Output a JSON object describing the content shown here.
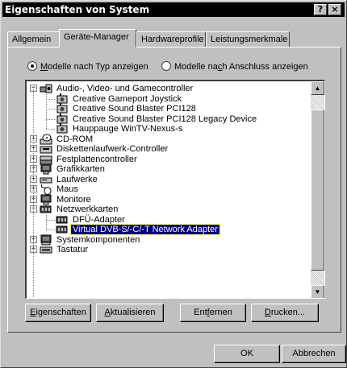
{
  "window": {
    "title": "Eigenschaften von System",
    "help_button": "?",
    "close_button": "×"
  },
  "tabs": [
    {
      "label": "Allgemein",
      "active": false
    },
    {
      "label": "Geräte-Manager",
      "active": true
    },
    {
      "label": "Hardwareprofile",
      "active": false
    },
    {
      "label": "Leistungsmerkmale",
      "active": false
    }
  ],
  "view_options": {
    "by_type": {
      "prefix": "",
      "accel": "M",
      "rest": "odelle nach Typ anzeigen",
      "checked": true
    },
    "by_connection": {
      "prefix": "Modelle na",
      "accel": "c",
      "rest": "h Anschluss anzeigen",
      "checked": false
    }
  },
  "tree": [
    {
      "level": 0,
      "expander": "−",
      "icon": "audio-icon",
      "label": "Audio-, Video- und Gamecontroller"
    },
    {
      "level": 1,
      "expander": "",
      "icon": "audio-device-icon",
      "label": "Creative Gameport Joystick"
    },
    {
      "level": 1,
      "expander": "",
      "icon": "audio-device-icon",
      "label": "Creative Sound Blaster PCI128"
    },
    {
      "level": 1,
      "expander": "",
      "icon": "audio-device-icon",
      "label": "Creative Sound Blaster PCI128 Legacy Device"
    },
    {
      "level": 1,
      "expander": "",
      "icon": "audio-device-icon",
      "label": "Hauppauge WinTV-Nexus-s"
    },
    {
      "level": 0,
      "expander": "+",
      "icon": "cdrom-icon",
      "label": "CD-ROM"
    },
    {
      "level": 0,
      "expander": "+",
      "icon": "floppy-icon",
      "label": "Diskettenlaufwerk-Controller"
    },
    {
      "level": 0,
      "expander": "+",
      "icon": "hdd-controller-icon",
      "label": "Festplattencontroller"
    },
    {
      "level": 0,
      "expander": "+",
      "icon": "graphics-card-icon",
      "label": "Grafikkarten"
    },
    {
      "level": 0,
      "expander": "+",
      "icon": "drive-icon",
      "label": "Laufwerke"
    },
    {
      "level": 0,
      "expander": "+",
      "icon": "mouse-icon",
      "label": "Maus"
    },
    {
      "level": 0,
      "expander": "+",
      "icon": "monitor-icon",
      "label": "Monitore"
    },
    {
      "level": 0,
      "expander": "−",
      "icon": "network-card-icon",
      "label": "Netzwerkkarten"
    },
    {
      "level": 1,
      "expander": "",
      "icon": "network-card-icon",
      "label": "DFÜ-Adapter"
    },
    {
      "level": 1,
      "expander": "",
      "icon": "network-card-icon",
      "label": "Virtual DVB-S/-C/-T Network Adapter",
      "selected": true
    },
    {
      "level": 0,
      "expander": "+",
      "icon": "system-component-icon",
      "label": "Systemkomponenten"
    },
    {
      "level": 0,
      "expander": "+",
      "icon": "keyboard-icon",
      "label": "Tastatur"
    }
  ],
  "buttons": {
    "properties": {
      "accel": "E",
      "rest": "igenschaften"
    },
    "refresh": {
      "accel": "A",
      "rest": "ktualisieren"
    },
    "remove": {
      "prefix": "Ent",
      "accel": "f",
      "rest": "ernen"
    },
    "print": {
      "accel": "D",
      "rest": "rucken..."
    },
    "ok": "OK",
    "cancel": "Abbrechen"
  }
}
